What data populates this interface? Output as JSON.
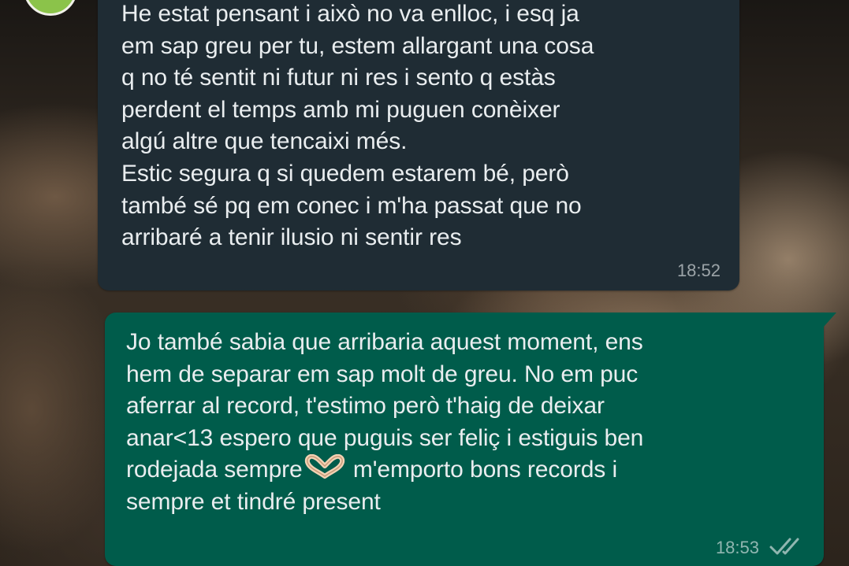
{
  "conversation": {
    "incoming": {
      "text": "He estat pensant i això no va enlloc, i esq ja\nem sap greu per tu, estem allargant una cosa\nq no té sentit ni futur ni res i sento q estàs\nperdent el temps amb mi puguen conèixer\nalgú altre que tencaixi més.\nEstic segura q si quedem estarem bé, però\ntambé sé pq em conec i m'ha passat que no\narribaré a tenir ilusio ni sentir res",
      "time": "18:52"
    },
    "outgoing": {
      "text_before_emoji": "Jo també sabia que arribaria aquest moment, ens\nhem de separar em sap molt de greu. No em puc\naferrar al record, t'estimo però t'haig de deixar\nanar<13 espero que puguis ser feliç i estiguis ben\nrodejada sempre",
      "emoji": "🫶🏻",
      "text_after_emoji": " m'emporto bons records i\nsempre et tindré present",
      "time": "18:53",
      "status_icon": "double-check-icon"
    }
  },
  "colors": {
    "incoming_bubble": "#1f2c34",
    "outgoing_bubble": "#005c4b",
    "message_text": "#e9edef",
    "avatar_accent": "#8bc34a"
  }
}
